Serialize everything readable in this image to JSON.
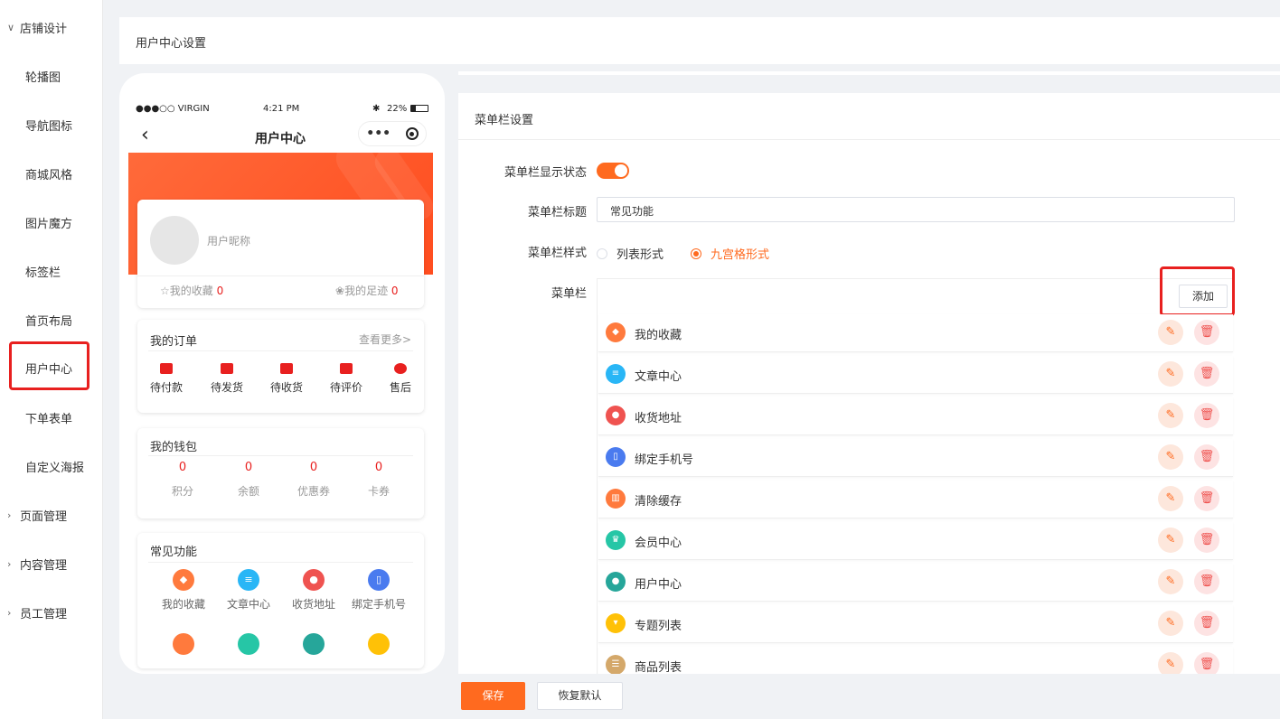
{
  "sidebar": {
    "groups": [
      {
        "label": "店铺设计",
        "expanded": true
      },
      {
        "label": "页面管理",
        "expanded": false
      },
      {
        "label": "内容管理",
        "expanded": false
      },
      {
        "label": "员工管理",
        "expanded": false
      }
    ],
    "items": [
      "轮播图",
      "导航图标",
      "商城风格",
      "图片魔方",
      "标签栏",
      "首页布局",
      "用户中心",
      "下单表单",
      "自定义海报"
    ],
    "active": "用户中心"
  },
  "page_title": "用户中心设置",
  "phone": {
    "status_carrier": "●●●○○ VIRGIN",
    "status_time": "4:21 PM",
    "status_battery": "22%",
    "nav_title": "用户中心",
    "nickname": "用户昵称",
    "favorites_label": "我的收藏",
    "favorites_count": "0",
    "footprint_label": "我的足迹",
    "footprint_count": "0",
    "orders_title": "我的订单",
    "orders_more": "查看更多>",
    "orders": [
      "待付款",
      "待发货",
      "待收货",
      "待评价",
      "售后"
    ],
    "wallet_title": "我的钱包",
    "wallet": [
      {
        "value": "0",
        "label": "积分"
      },
      {
        "value": "0",
        "label": "余额"
      },
      {
        "value": "0",
        "label": "优惠券"
      },
      {
        "value": "0",
        "label": "卡券"
      }
    ],
    "functions_title": "常见功能",
    "functions": [
      "我的收藏",
      "文章中心",
      "收货地址",
      "绑定手机号"
    ]
  },
  "panel": {
    "title": "菜单栏设置",
    "show_label": "菜单栏显示状态",
    "show_enabled": true,
    "title_label": "菜单栏标题",
    "title_value": "常见功能",
    "style_label": "菜单栏样式",
    "style_options": [
      "列表形式",
      "九宫格形式"
    ],
    "style_selected": "九宫格形式",
    "menu_label": "菜单栏",
    "add_label": "添加",
    "menu_items": [
      {
        "label": "我的收藏",
        "color": "#ff7a3d",
        "icon": "box-icon"
      },
      {
        "label": "文章中心",
        "color": "#29b6f6",
        "icon": "document-icon"
      },
      {
        "label": "收货地址",
        "color": "#ef5350",
        "icon": "location-icon"
      },
      {
        "label": "绑定手机号",
        "color": "#4a7bef",
        "icon": "phone-icon"
      },
      {
        "label": "清除缓存",
        "color": "#ff7a3d",
        "icon": "trash-icon"
      },
      {
        "label": "会员中心",
        "color": "#26c6a6",
        "icon": "crown-icon"
      },
      {
        "label": "用户中心",
        "color": "#26a69a",
        "icon": "user-icon"
      },
      {
        "label": "专题列表",
        "color": "#ffc107",
        "icon": "bookmark-icon"
      },
      {
        "label": "商品列表",
        "color": "#d4a86a",
        "icon": "list-icon"
      }
    ]
  },
  "buttons": {
    "save": "保存",
    "reset": "恢复默认"
  },
  "colors": {
    "accent": "#ff6a1f",
    "highlight": "#e8201f"
  }
}
